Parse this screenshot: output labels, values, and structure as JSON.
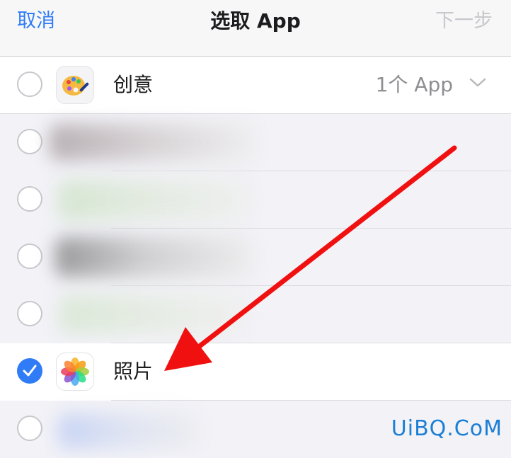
{
  "navbar": {
    "cancel_label": "取消",
    "title": "选取 App",
    "next_label": "下一步"
  },
  "rows": [
    {
      "label": "创意",
      "count": "1个 App",
      "selected": false,
      "icon": "palette-icon",
      "expandable": true
    },
    {
      "label": "",
      "selected": false,
      "blurred": true
    },
    {
      "label": "",
      "selected": false,
      "blurred": true
    },
    {
      "label": "",
      "selected": false,
      "blurred": true
    },
    {
      "label": "",
      "selected": false,
      "blurred": true
    },
    {
      "label": "照片",
      "selected": true,
      "icon": "photos-icon"
    },
    {
      "label": "",
      "selected": false,
      "blurred": true
    }
  ],
  "colors": {
    "accent": "#2f7cf6",
    "annotation_arrow": "#f01010"
  },
  "watermark": "UiBQ.CoM"
}
